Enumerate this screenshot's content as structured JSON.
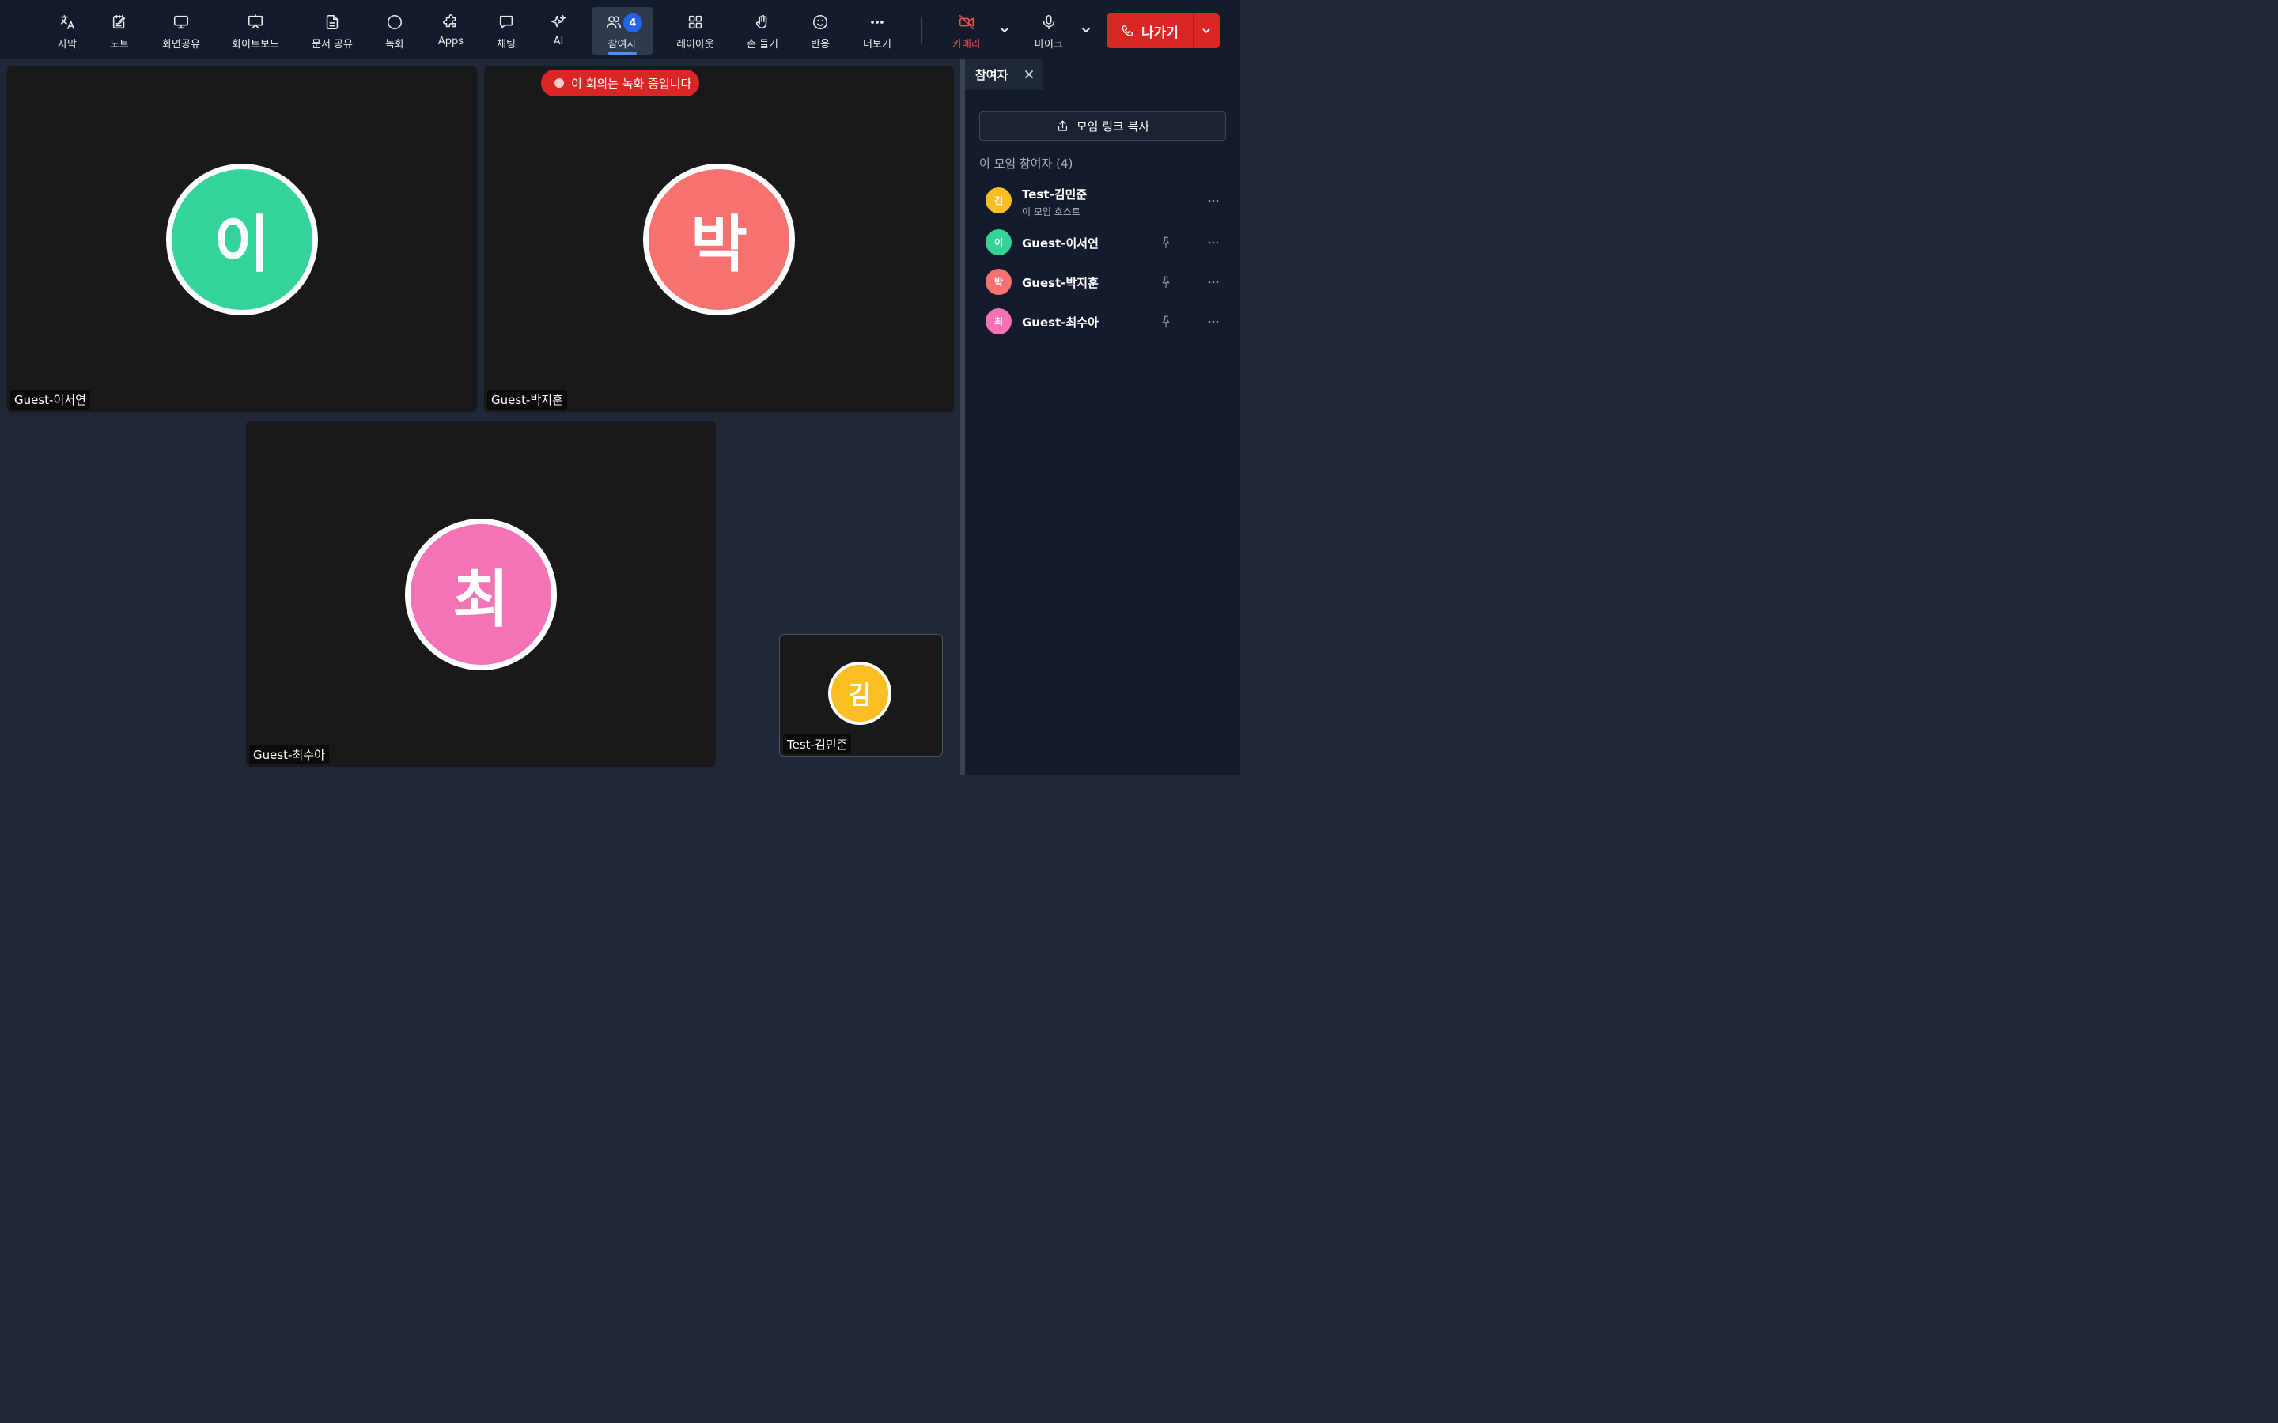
{
  "toolbar": {
    "tools": [
      {
        "id": "caption",
        "label": "자막",
        "icon": "translate-icon"
      },
      {
        "id": "notes",
        "label": "노트",
        "icon": "note-edit-icon"
      },
      {
        "id": "screenshare",
        "label": "화면공유",
        "icon": "monitor-icon"
      },
      {
        "id": "whiteboard",
        "label": "화이트보드",
        "icon": "presentation-board-icon"
      },
      {
        "id": "docshare",
        "label": "문서 공유",
        "icon": "document-icon"
      },
      {
        "id": "record",
        "label": "녹화",
        "icon": "record-circle-icon"
      },
      {
        "id": "apps",
        "label": "Apps",
        "icon": "puzzle-icon"
      },
      {
        "id": "chat",
        "label": "채팅",
        "icon": "chat-bubble-icon"
      },
      {
        "id": "ai",
        "label": "AI",
        "icon": "sparkles-icon"
      },
      {
        "id": "participants",
        "label": "참여자",
        "icon": "users-icon",
        "badge": "4"
      },
      {
        "id": "layout",
        "label": "레이아웃",
        "icon": "grid-layout-icon"
      },
      {
        "id": "raisehand",
        "label": "손 들기",
        "icon": "hand-icon"
      },
      {
        "id": "reaction",
        "label": "반응",
        "icon": "smile-icon"
      },
      {
        "id": "more",
        "label": "더보기",
        "icon": "ellipsis-icon"
      }
    ],
    "camera_label": "카메라",
    "mic_label": "마이크",
    "leave_label": "나가기"
  },
  "recording_banner": "이 회의는 녹화 중입니다",
  "tiles": [
    {
      "name": "Guest-이서연",
      "initial": "이",
      "color": "#34d399"
    },
    {
      "name": "Guest-박지훈",
      "initial": "박",
      "color": "#f87171"
    },
    {
      "name": "Guest-최수아",
      "initial": "최",
      "color": "#f472b6"
    },
    {
      "name": "Test-김민준",
      "initial": "김",
      "color": "#fbbf24"
    }
  ],
  "panel": {
    "tab_title": "참여자",
    "copy_link_label": "모임 링크 복사",
    "list_title": "이 모임 참여자 (4)",
    "participants": [
      {
        "initial": "김",
        "name": "Test-김민준",
        "sub": "이 모임 호스트",
        "color": "#fbbf24"
      },
      {
        "initial": "이",
        "name": "Guest-이서연",
        "color": "#34d399"
      },
      {
        "initial": "박",
        "name": "Guest-박지훈",
        "color": "#f87171"
      },
      {
        "initial": "최",
        "name": "Guest-최수아",
        "color": "#f472b6"
      }
    ]
  },
  "colors": {
    "accent": "#2563eb",
    "danger": "#dc2626",
    "background": "#1f2736",
    "toolbar": "#141b2b"
  }
}
